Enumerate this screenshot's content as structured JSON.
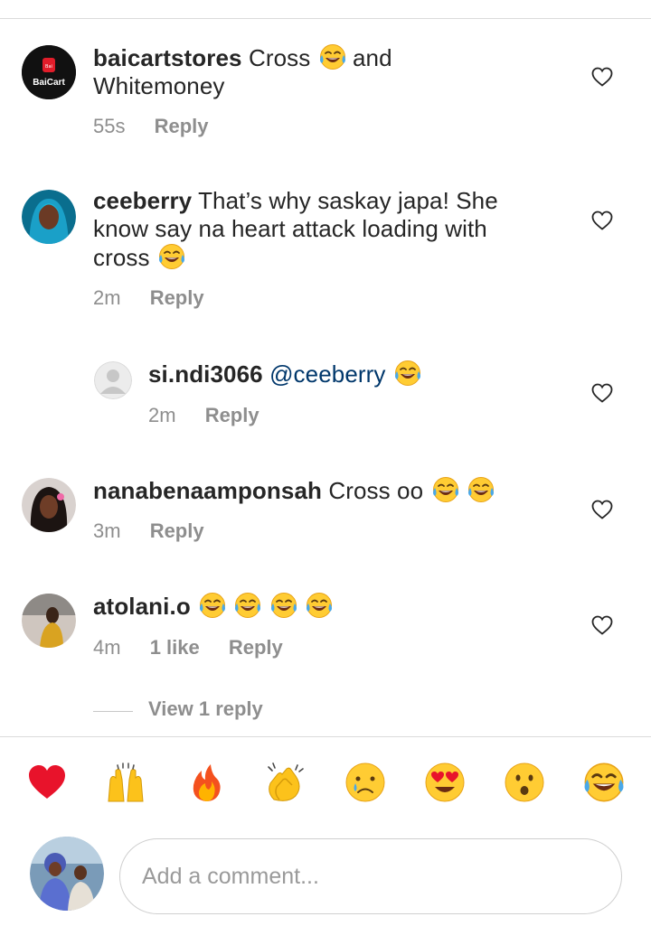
{
  "comments": [
    {
      "username": "baicartstores",
      "text_a": "Cross",
      "text_b": "and",
      "text_line2": "Whitemoney",
      "time": "55s",
      "reply": "Reply",
      "avatar_text": "BaiCart"
    },
    {
      "username": "ceeberry",
      "text_line1": "That’s why saskay japa! She",
      "text_line2": "know say na heart attack loading with",
      "text_line3": "cross",
      "time": "2m",
      "reply": "Reply"
    },
    {
      "username": "si.ndi3066",
      "mention": "@ceeberry",
      "time": "2m",
      "reply": "Reply"
    },
    {
      "username": "nanabenaamponsah",
      "text": "Cross oo",
      "time": "3m",
      "reply": "Reply"
    },
    {
      "username": "atolani.o",
      "time": "4m",
      "likes": "1 like",
      "reply": "Reply"
    }
  ],
  "view_replies": "View 1 reply",
  "reactions": [
    "heart",
    "raising-hands",
    "fire",
    "clapping-hands",
    "crying-face",
    "heart-eyes",
    "surprised-face",
    "tears-of-joy"
  ],
  "comment_input": {
    "placeholder": "Add a comment..."
  },
  "colors": {
    "text": "#262626",
    "secondary": "#8e8e8e",
    "mention": "#00376b",
    "divider": "#dbdbdb"
  }
}
